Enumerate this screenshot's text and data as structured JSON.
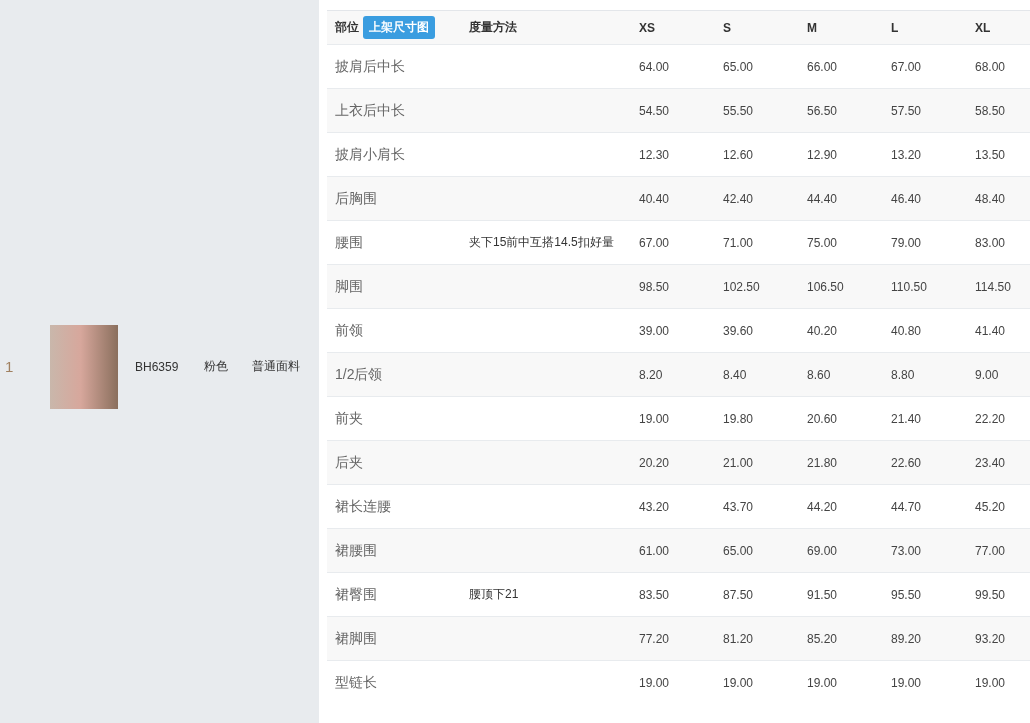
{
  "product": {
    "index": "1",
    "code": "BH6359",
    "color_name": "粉色",
    "fabric": "普通面料"
  },
  "table": {
    "columns": [
      {
        "label": "部位",
        "badge": "上架尺寸图"
      },
      {
        "label": "度量方法"
      },
      {
        "label": "XS"
      },
      {
        "label": "S"
      },
      {
        "label": "M"
      },
      {
        "label": "L"
      },
      {
        "label": "XL"
      }
    ],
    "rows": [
      {
        "part": "披肩后中长",
        "method": "",
        "values": [
          "64.00",
          "65.00",
          "66.00",
          "67.00",
          "68.00"
        ]
      },
      {
        "part": "上衣后中长",
        "method": "",
        "values": [
          "54.50",
          "55.50",
          "56.50",
          "57.50",
          "58.50"
        ]
      },
      {
        "part": "披肩小肩长",
        "method": "",
        "values": [
          "12.30",
          "12.60",
          "12.90",
          "13.20",
          "13.50"
        ]
      },
      {
        "part": "后胸围",
        "method": "",
        "values": [
          "40.40",
          "42.40",
          "44.40",
          "46.40",
          "48.40"
        ]
      },
      {
        "part": "腰围",
        "method": "夹下15前中互搭14.5扣好量",
        "values": [
          "67.00",
          "71.00",
          "75.00",
          "79.00",
          "83.00"
        ]
      },
      {
        "part": "脚围",
        "method": "",
        "values": [
          "98.50",
          "102.50",
          "106.50",
          "110.50",
          "114.50"
        ]
      },
      {
        "part": "前领",
        "method": "",
        "values": [
          "39.00",
          "39.60",
          "40.20",
          "40.80",
          "41.40"
        ]
      },
      {
        "part": "1/2后领",
        "method": "",
        "values": [
          "8.20",
          "8.40",
          "8.60",
          "8.80",
          "9.00"
        ]
      },
      {
        "part": "前夹",
        "method": "",
        "values": [
          "19.00",
          "19.80",
          "20.60",
          "21.40",
          "22.20"
        ]
      },
      {
        "part": "后夹",
        "method": "",
        "values": [
          "20.20",
          "21.00",
          "21.80",
          "22.60",
          "23.40"
        ]
      },
      {
        "part": "裙长连腰",
        "method": "",
        "values": [
          "43.20",
          "43.70",
          "44.20",
          "44.70",
          "45.20"
        ]
      },
      {
        "part": "裙腰围",
        "method": "",
        "values": [
          "61.00",
          "65.00",
          "69.00",
          "73.00",
          "77.00"
        ]
      },
      {
        "part": "裙臀围",
        "method": "腰顶下21",
        "values": [
          "83.50",
          "87.50",
          "91.50",
          "95.50",
          "99.50"
        ]
      },
      {
        "part": "裙脚围",
        "method": "",
        "values": [
          "77.20",
          "81.20",
          "85.20",
          "89.20",
          "93.20"
        ]
      },
      {
        "part": "型链长",
        "method": "",
        "values": [
          "19.00",
          "19.00",
          "19.00",
          "19.00",
          "19.00"
        ]
      }
    ]
  }
}
